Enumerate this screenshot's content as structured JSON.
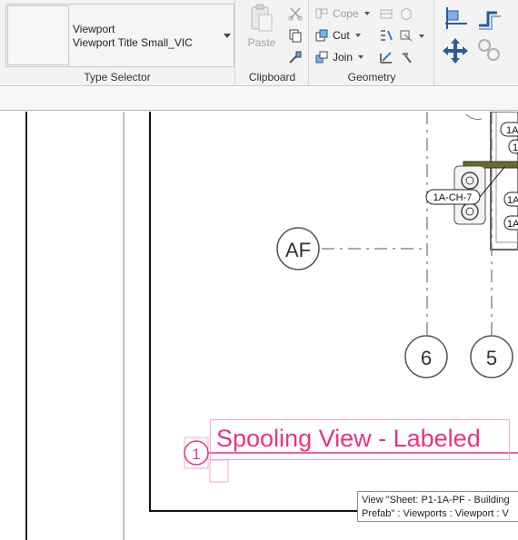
{
  "ribbon": {
    "type_selector": {
      "family": "Viewport",
      "type": "Viewport Title Small_VIC",
      "panel_title": "Type Selector"
    },
    "clipboard": {
      "paste_label": "Paste",
      "panel_title": "Clipboard"
    },
    "geometry": {
      "cope_label": "Cope",
      "cut_label": "Cut",
      "join_label": "Join",
      "panel_title": "Geometry"
    }
  },
  "drawing": {
    "grid_bubbles": [
      "AF",
      "6",
      "5"
    ],
    "tag_labels": [
      "1A-CH-7",
      "1A",
      "1A",
      "1A",
      "1"
    ],
    "viewport_number": "1",
    "viewport_title": "Spooling View - Labeled",
    "title_color": "#e8357f"
  },
  "tooltip": {
    "line1": "View \"Sheet: P1-1A-PF - Building",
    "line2": "Prefab\" : Viewports : Viewport : V"
  }
}
